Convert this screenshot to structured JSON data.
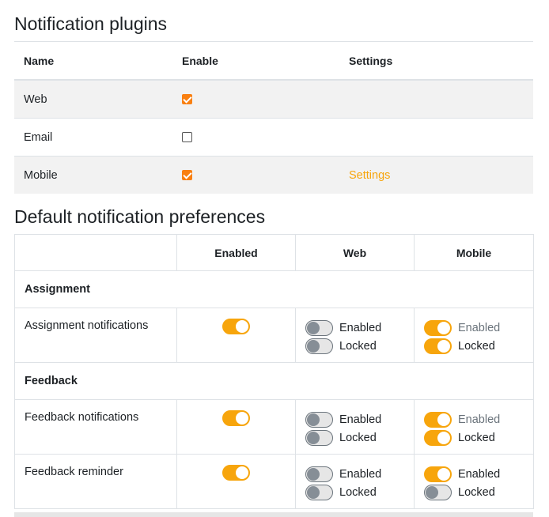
{
  "plugins": {
    "title": "Notification plugins",
    "headers": {
      "name": "Name",
      "enable": "Enable",
      "settings": "Settings"
    },
    "rows": [
      {
        "name": "Web",
        "enabled": true,
        "settings_link": ""
      },
      {
        "name": "Email",
        "enabled": false,
        "settings_link": ""
      },
      {
        "name": "Mobile",
        "enabled": true,
        "settings_link": "Settings"
      }
    ]
  },
  "prefs": {
    "title": "Default notification preferences",
    "headers": {
      "enabled": "Enabled",
      "web": "Web",
      "mobile": "Mobile"
    },
    "sections": [
      {
        "name": "Assignment",
        "items": [
          {
            "label": "Assignment notifications",
            "enabled": true,
            "web": {
              "enabled": false,
              "enabled_label": "Enabled",
              "locked": false,
              "locked_label": "Locked"
            },
            "mobile": {
              "enabled": true,
              "enabled_label": "Enabled",
              "locked": true,
              "locked_label": "Locked"
            }
          }
        ]
      },
      {
        "name": "Feedback",
        "items": [
          {
            "label": "Feedback notifications",
            "enabled": true,
            "web": {
              "enabled": false,
              "enabled_label": "Enabled",
              "locked": false,
              "locked_label": "Locked"
            },
            "mobile": {
              "enabled": true,
              "enabled_label": "Enabled",
              "locked": true,
              "locked_label": "Locked"
            }
          },
          {
            "label": "Feedback reminder",
            "enabled": true,
            "web": {
              "enabled": false,
              "enabled_label": "Enabled",
              "locked": false,
              "locked_label": "Locked"
            },
            "mobile": {
              "enabled": true,
              "enabled_label": "Enabled",
              "locked": false,
              "locked_label": "Locked"
            }
          }
        ]
      }
    ]
  },
  "colors": {
    "accent": "#f7a50c",
    "checkbox": "#f98012",
    "link": "#f7a50c"
  }
}
